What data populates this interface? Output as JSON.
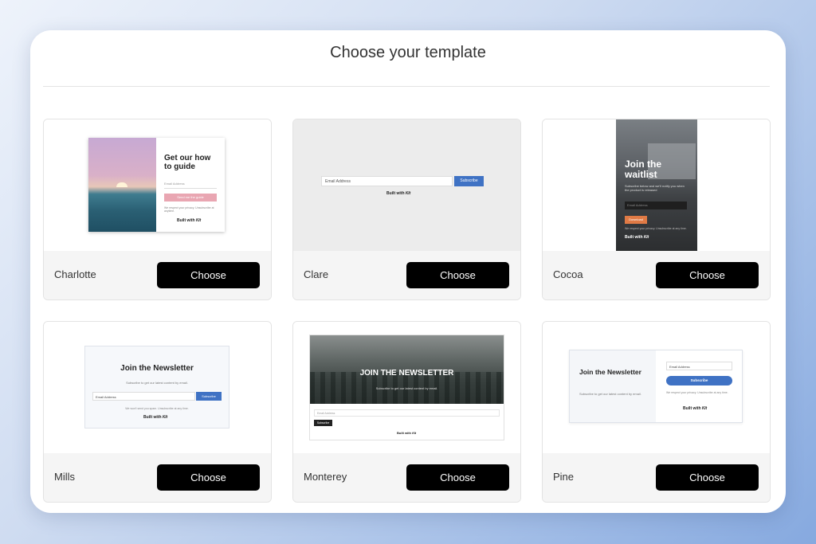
{
  "page": {
    "title": "Choose your template"
  },
  "templates": [
    {
      "name": "Charlotte",
      "choose_label": "Choose",
      "preview": {
        "heading": "Get our how to guide",
        "email_placeholder": "Email Address",
        "button": "Send me the guide",
        "note": "We respect your privacy. Unsubscribe at anytime.",
        "built_with": "Built with",
        "brand": "Kit"
      }
    },
    {
      "name": "Clare",
      "choose_label": "Choose",
      "preview": {
        "email_placeholder": "Email Address",
        "button": "Subscribe",
        "built_with": "Built with",
        "brand": "Kit"
      }
    },
    {
      "name": "Cocoa",
      "choose_label": "Choose",
      "preview": {
        "heading": "Join the waitlist",
        "subtitle": "Subscribe below and we'll notify you when the product is released",
        "email_placeholder": "Email Address",
        "button": "Download",
        "note": "We respect your privacy. Unsubscribe at any time.",
        "built_with": "Built with",
        "brand": "Kit"
      }
    },
    {
      "name": "Mills",
      "choose_label": "Choose",
      "preview": {
        "heading": "Join the Newsletter",
        "subtitle": "Subscribe to get our latest content by email.",
        "email_placeholder": "Email Address",
        "button": "Subscribe",
        "note": "We won't send you spam. Unsubscribe at any time.",
        "built_with": "Built with",
        "brand": "Kit"
      }
    },
    {
      "name": "Monterey",
      "choose_label": "Choose",
      "preview": {
        "heading": "JOIN THE NEWSLETTER",
        "subtitle": "Subscribe to get our latest content by email.",
        "email_placeholder": "Email Address",
        "button": "Subscribe",
        "built_with": "Built with",
        "brand": "Kit"
      }
    },
    {
      "name": "Pine",
      "choose_label": "Choose",
      "preview": {
        "heading": "Join the Newsletter",
        "subtitle": "Subscribe to get our latest content by email.",
        "email_placeholder": "Email Address",
        "button": "Subscribe",
        "note": "We respect your privacy. Unsubscribe at any time.",
        "built_with": "Built with",
        "brand": "Kit"
      }
    }
  ],
  "colors": {
    "accent_blue": "#3f72c4",
    "choose_button": "#000000",
    "charlotte_button": "#e9a6b2",
    "cocoa_button": "#e07a45"
  }
}
